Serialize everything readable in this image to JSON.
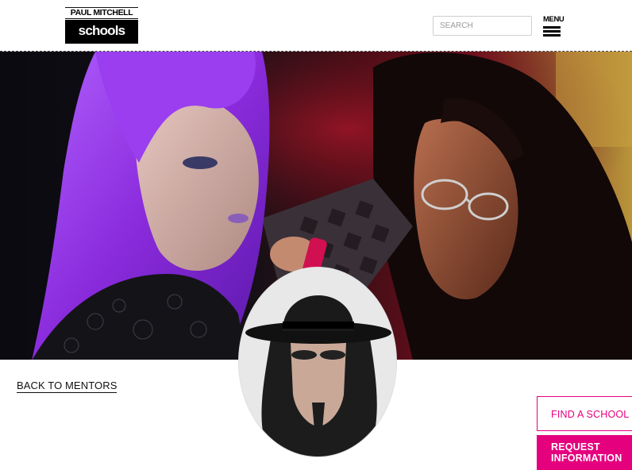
{
  "header": {
    "logo_top": "PAUL MITCHELL",
    "logo_bottom": "schools",
    "search_placeholder": "SEARCH",
    "menu_label": "MENU"
  },
  "main": {
    "back_link": "BACK TO MENTORS"
  },
  "cta": {
    "find_school": "FIND A SCHOOL",
    "request_line1": "REQUEST",
    "request_line2": "INFORMATION"
  },
  "colors": {
    "accent": "#e5007e"
  }
}
